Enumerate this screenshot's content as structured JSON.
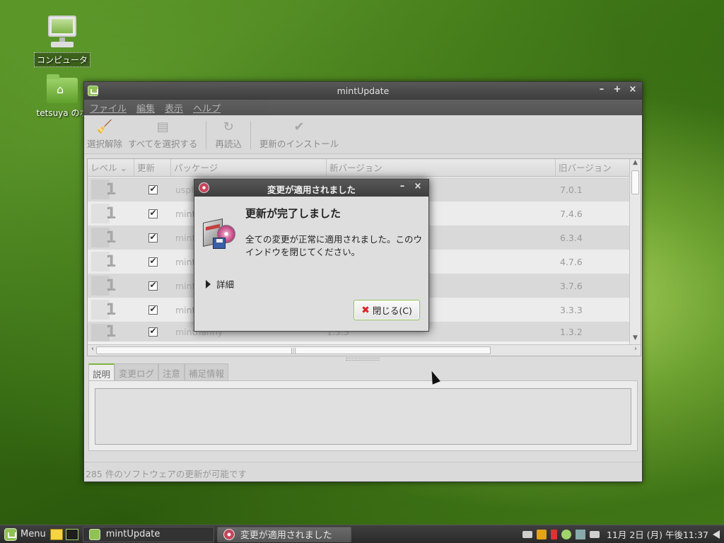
{
  "desktop": {
    "icons": [
      {
        "label": "コンピュータ"
      },
      {
        "label": "tetsuya のホ"
      }
    ]
  },
  "main_window": {
    "title": "mintUpdate",
    "menu": [
      "ファイル",
      "編集",
      "表示",
      "ヘルプ"
    ],
    "toolbar": {
      "clear": "選択解除",
      "select_all": "すべてを選択する",
      "refresh": "再読込",
      "install": "更新のインストール"
    },
    "columns": {
      "level": "レベル",
      "update": "更新",
      "package": "パッケージ",
      "new_version": "新バージョン",
      "old_version": "旧バージョン"
    },
    "rows": [
      {
        "level": "1",
        "package": "uspla",
        "new_version": "",
        "old_version": "7.0.1"
      },
      {
        "level": "1",
        "package": "mint",
        "new_version": "",
        "old_version": "7.4.6"
      },
      {
        "level": "1",
        "package": "mint",
        "new_version": "",
        "old_version": "6.3.4"
      },
      {
        "level": "1",
        "package": "mint",
        "new_version": "",
        "old_version": "4.7.6"
      },
      {
        "level": "1",
        "package": "mint",
        "new_version": "",
        "old_version": "3.7.6"
      },
      {
        "level": "1",
        "package": "mint",
        "new_version": "",
        "old_version": "3.3.3"
      },
      {
        "level": "1",
        "package": "mintnanny",
        "new_version": "1.3.3",
        "old_version": "1.3.2"
      }
    ],
    "tabs": [
      "説明",
      "変更ログ",
      "注意",
      "補足情報"
    ],
    "status": "285 件のソフトウェアの更新が可能です"
  },
  "dialog": {
    "title": "変更が適用されました",
    "heading": "更新が完了しました",
    "message": "全ての変更が正常に適用されました。このウインドウを閉じてください。",
    "details": "詳細",
    "close_button": "閉じる(C)"
  },
  "taskbar": {
    "menu_label": "Menu",
    "tasks": [
      "mintUpdate",
      "変更が適用されました"
    ],
    "clock": "11月 2日 (月) 午後11:37"
  }
}
